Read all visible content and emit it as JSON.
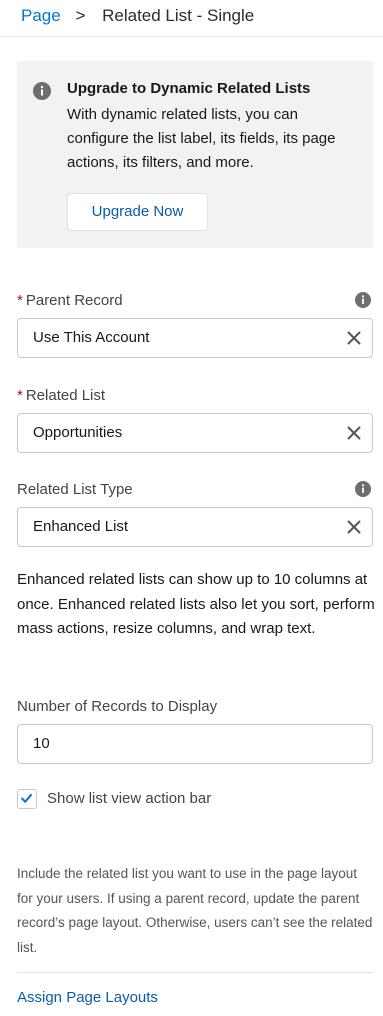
{
  "breadcrumb": {
    "parent": "Page",
    "separator": ">",
    "current": "Related List - Single"
  },
  "upgrade_panel": {
    "title": "Upgrade to Dynamic Related Lists",
    "body": "With dynamic related lists, you can configure the list label, its fields, its page actions, its filters, and more.",
    "button_label": "Upgrade Now",
    "icon": "info-icon"
  },
  "fields": {
    "parent_record": {
      "required_mark": "*",
      "label": "Parent Record",
      "value": "Use This Account"
    },
    "related_list": {
      "required_mark": "*",
      "label": "Related List",
      "value": "Opportunities"
    },
    "related_list_type": {
      "label": "Related List Type",
      "value": "Enhanced List"
    },
    "number_of_records": {
      "label": "Number of Records to Display",
      "value": "10"
    }
  },
  "type_description": "Enhanced related lists can show up to 10 columns at once. Enhanced related lists also let you sort, perform mass actions, resize columns, and wrap text.",
  "show_action_bar": {
    "label": "Show list view action bar",
    "checked": true
  },
  "footer_note": "Include the related list you want to use in the page layout for your users. If using a parent record, update the parent record’s page layout. Otherwise, users can’t see the related list.",
  "assign_link": "Assign Page Layouts",
  "colors": {
    "link": "#0b5cab",
    "required": "#ba0517",
    "panel_bg": "#f3f2f2",
    "check": "#0176d3"
  }
}
